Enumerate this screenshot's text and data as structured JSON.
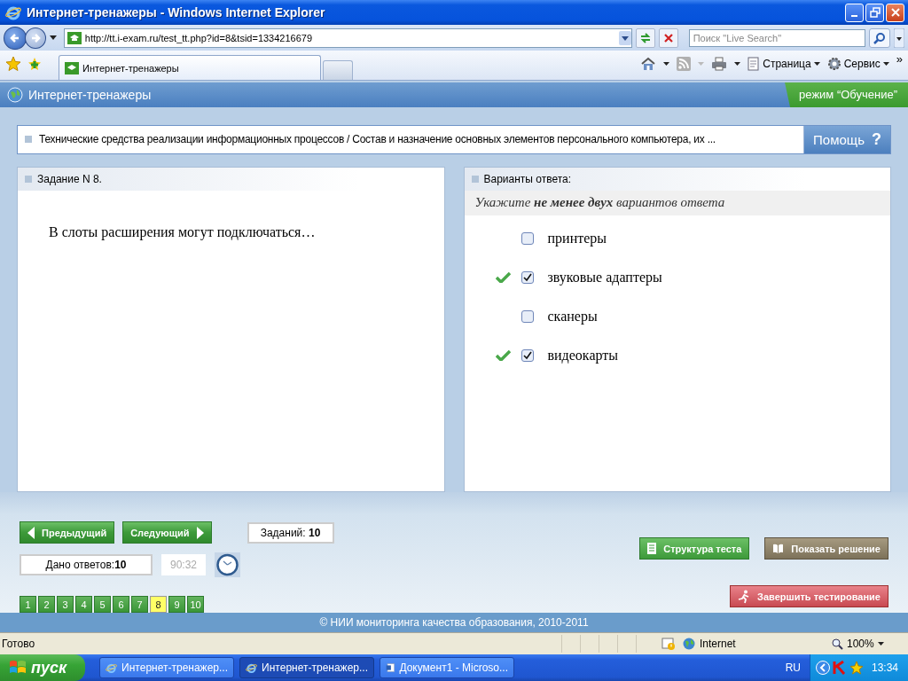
{
  "window": {
    "title": "Интернет-тренажеры - Windows Internet Explorer"
  },
  "address_bar": {
    "url": "http://tt.i-exam.ru/test_tt.php?id=8&tsid=1334216679"
  },
  "search": {
    "placeholder": "Поиск \"Live Search\""
  },
  "tabs": [
    {
      "label": "Интернет-тренажеры",
      "selected": true
    }
  ],
  "command_bar": {
    "items": [
      {
        "label": "Страница",
        "kind": "page"
      },
      {
        "label": "Сервис",
        "kind": "tools"
      }
    ],
    "more": "»"
  },
  "site_header": {
    "title": "Интернет-тренажеры",
    "mode": "режим “Обучение”"
  },
  "breadcrumb": "Технические средства реализации информационных процессов / Состав и назначение основных элементов персонального компьютера, их ...",
  "help_button": {
    "label": "Помощь",
    "icon": "?"
  },
  "task": {
    "heading": "Задание N 8.",
    "question": "В слоты расширения могут подключаться…"
  },
  "answers": {
    "heading": "Варианты ответа:",
    "instruction": "Укажите **не менее двух** вариантов ответа",
    "options": [
      {
        "label": "принтеры",
        "checked": false,
        "correct": false
      },
      {
        "label": "звуковые адаптеры",
        "checked": true,
        "correct": true
      },
      {
        "label": "сканеры",
        "checked": false,
        "correct": false
      },
      {
        "label": "видеокарты",
        "checked": true,
        "correct": true
      }
    ]
  },
  "navigation": {
    "previous": "Предыдущий",
    "next": "Следующий",
    "tasks_total": "Заданий: **10**",
    "answered": "Дано ответов:**10**",
    "timer": "90:32"
  },
  "pages": [
    {
      "label": "1",
      "selected": false
    },
    {
      "label": "2",
      "selected": false
    },
    {
      "label": "3",
      "selected": false
    },
    {
      "label": "4",
      "selected": false
    },
    {
      "label": "5",
      "selected": false
    },
    {
      "label": "6",
      "selected": false
    },
    {
      "label": "7",
      "selected": false
    },
    {
      "label": "8",
      "selected": true
    },
    {
      "label": "9",
      "selected": false
    },
    {
      "label": "10",
      "selected": false
    }
  ],
  "actions": {
    "structure": "Структура теста",
    "solution": "Показать решение",
    "finish": "Завершить тестирование"
  },
  "footer": "© НИИ мониторинга качества образования, 2010-2011",
  "status_bar": {
    "text": "Готово",
    "zone": "Internet",
    "zoom": "100%"
  },
  "taskbar": {
    "start": "пуск",
    "tasks": [
      {
        "label": "Интернет-тренажер...",
        "kind": "browser",
        "selected": false
      },
      {
        "label": "Интернет-тренажер...",
        "kind": "browser",
        "selected": true
      },
      {
        "label": "Документ1 - Microso...",
        "kind": "document",
        "selected": false
      }
    ],
    "language": "RU",
    "clock": "13:34"
  }
}
